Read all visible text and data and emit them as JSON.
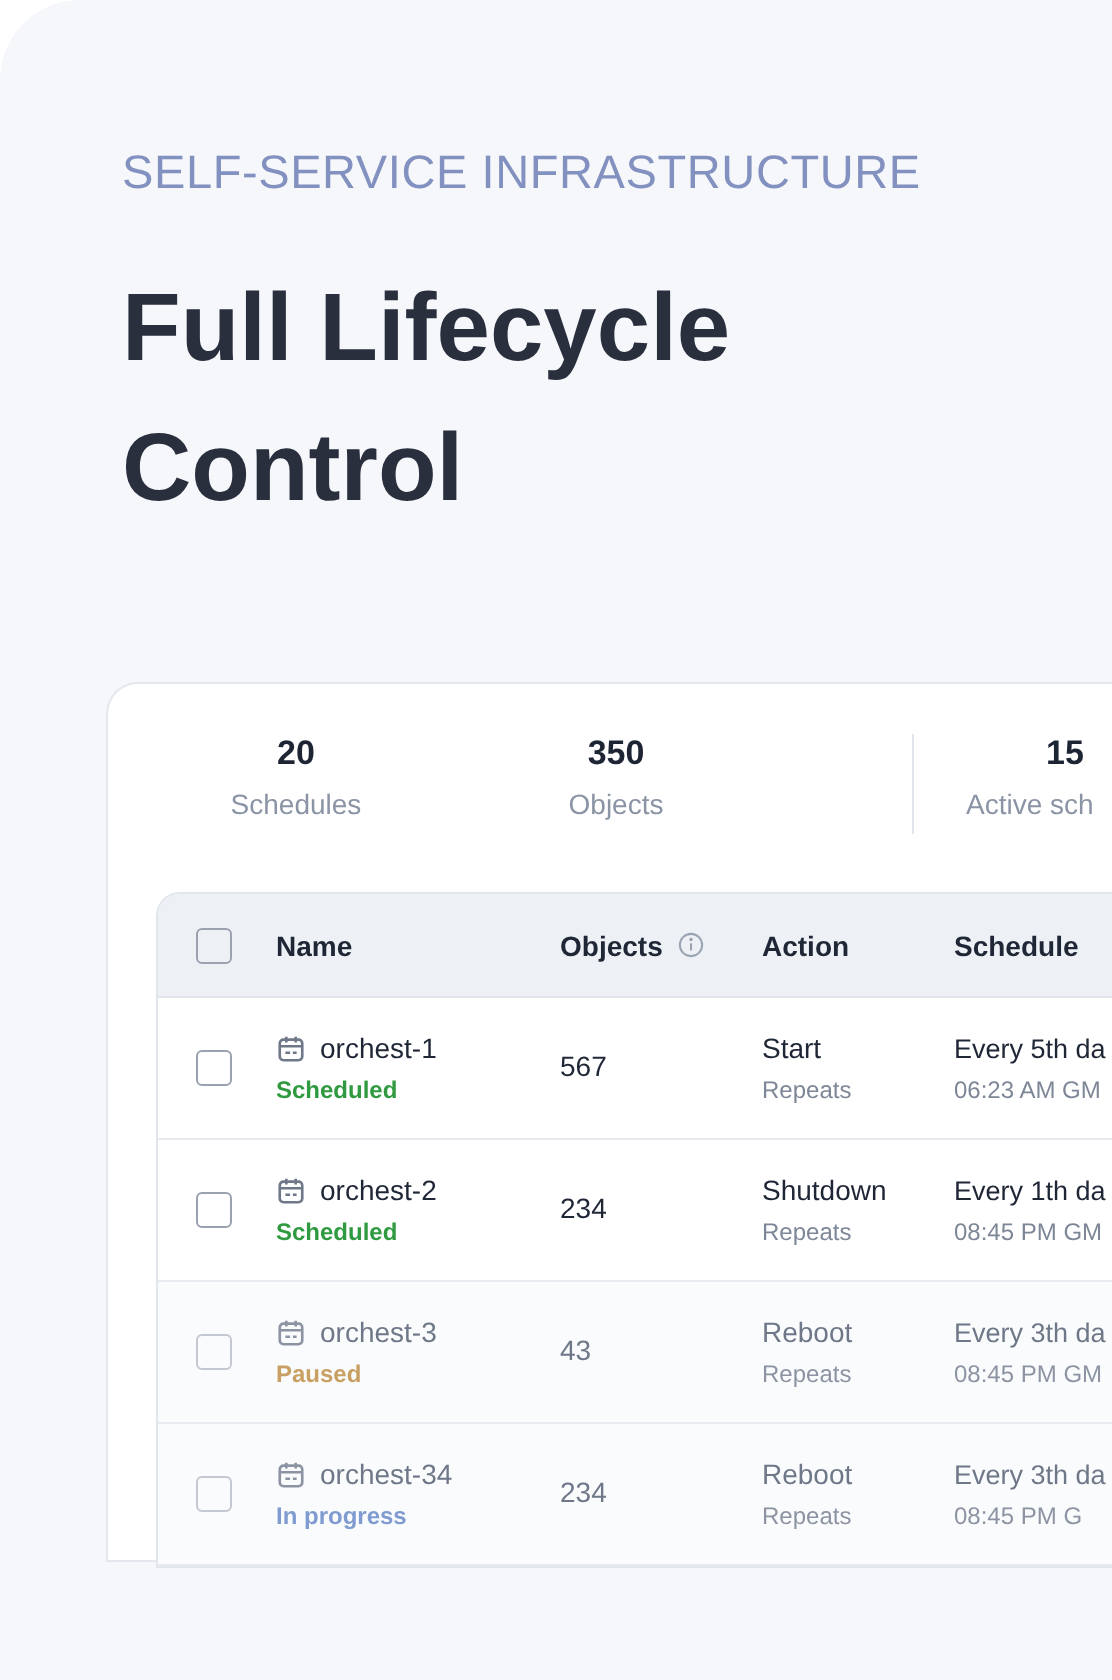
{
  "eyebrow": "SELF-SERVICE INFRASTRUCTURE",
  "title": "Full Lifecycle Control",
  "stats": [
    {
      "value": "20",
      "label": "Schedules"
    },
    {
      "value": "350",
      "label": "Objects"
    },
    {
      "value": "15",
      "label": "Active sch"
    }
  ],
  "table": {
    "select_all_checked": false,
    "columns": [
      {
        "label": "Name",
        "info": false
      },
      {
        "label": "Objects",
        "info": true
      },
      {
        "label": "Action",
        "info": false
      },
      {
        "label": "Schedule",
        "info": false
      }
    ],
    "rows": [
      {
        "checked": false,
        "faded": false,
        "name": "orchest-1",
        "status": "Scheduled",
        "color": "#2f9a3f",
        "objects": "567",
        "action": "Start",
        "action_note": "Repeats",
        "schedule": "Every 5th da",
        "time": "06:23 AM GM"
      },
      {
        "checked": false,
        "faded": false,
        "name": "orchest-2",
        "status": "Scheduled",
        "color": "#2f9a3f",
        "objects": "234",
        "action": "Shutdown",
        "action_note": "Repeats",
        "schedule": "Every 1th da",
        "time": "08:45 PM GM"
      },
      {
        "checked": false,
        "faded": true,
        "name": "orchest-3",
        "status": "Paused",
        "color": "#c9a063",
        "objects": "43",
        "action": "Reboot",
        "action_note": "Repeats",
        "schedule": "Every 3th da",
        "time": "08:45 PM GM"
      },
      {
        "checked": false,
        "faded": true,
        "name": "orchest-34",
        "status": "In progress",
        "color": "#7f9bcf",
        "objects": "234",
        "action": "Reboot",
        "action_note": "Repeats",
        "schedule": "Every 3th da",
        "time": "08:45 PM G"
      }
    ]
  }
}
